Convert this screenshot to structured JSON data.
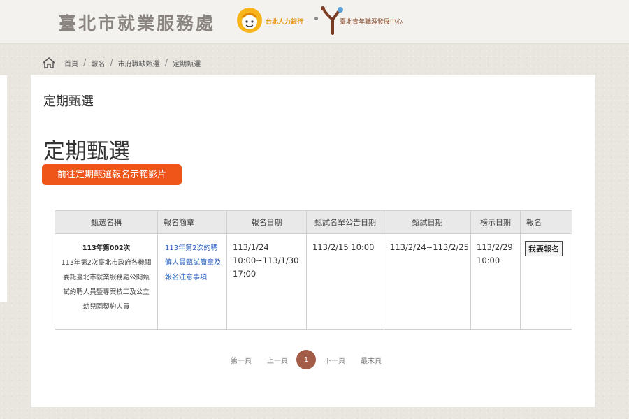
{
  "header": {
    "site_title": "臺北市就業服務處",
    "logo1_text": "台北人力銀行",
    "logo2_text": "臺北青年職涯發展中心"
  },
  "breadcrumb": {
    "items": [
      "首頁",
      "報名",
      "市府職缺甄選",
      "定期甄選"
    ]
  },
  "main": {
    "title_small": "定期甄選",
    "title_large": "定期甄選",
    "video_button_label": "前往定期甄選報名示範影片"
  },
  "table": {
    "headers": [
      "甄選名稱",
      "報名簡章",
      "報名日期",
      "甄試名單公告日期",
      "甄試日期",
      "榜示日期",
      "報名"
    ],
    "rows": [
      {
        "selection_id": "113年第002次",
        "selection_name": "113年第2次臺北市政府各機關委託臺北市就業服務處公開甄試約聘人員暨專案技工及公立幼兒園契約人員",
        "brochure_link": "113年第2次約聘僱人員甄試簡章及報名注意事項",
        "signup_date": "113/1/24 10:00~113/1/30 17:00",
        "announce_date": "113/2/15 10:00",
        "exam_date": "113/2/24~113/2/25",
        "result_date": "113/2/29 10:00",
        "signup_button": "我要報名"
      }
    ]
  },
  "pagination": {
    "first": "第一頁",
    "prev": "上一頁",
    "current": "1",
    "next": "下一頁",
    "last": "最末頁"
  },
  "colors": {
    "accent": "#ef5418",
    "pagination_current": "#a25c48",
    "link": "#2a5fbf",
    "header_text": "#8a8580"
  }
}
